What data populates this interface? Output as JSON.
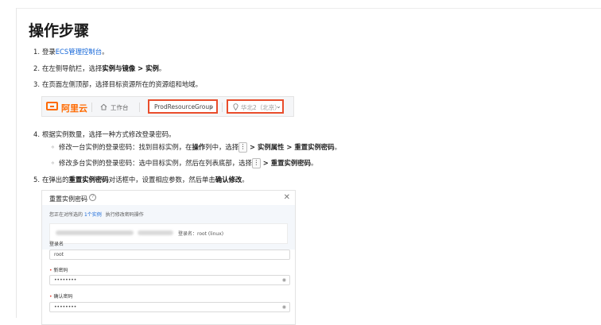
{
  "page": {
    "heading": "操作步骤"
  },
  "steps": [
    {
      "num": "1.",
      "pre": "登录",
      "link": "ECS管理控制台",
      "post": "。"
    },
    {
      "num": "2.",
      "pre": "在左侧导航栏，选择",
      "bold": "实例与镜像 > 实例",
      "post": "。"
    },
    {
      "num": "3.",
      "text": "在页面左侧顶部，选择目标资源所在的资源组和地域。"
    },
    {
      "num": "4.",
      "text": "根据实例数量，选择一种方式修改登录密码。",
      "subs": [
        {
          "bullet": "◦",
          "pre": "修改一台实例的登录密码：找到目标实例，在",
          "bold1": "操作",
          "mid": "列中，选择",
          "kbd": "⋮",
          "bold2": " > 实例属性 > 重置实例密码",
          "post": "。"
        },
        {
          "bullet": "◦",
          "pre": "修改多台实例的登录密码：选中目标实例，然后在列表底部，选择",
          "kbd": "⋮",
          "bold2": " > 重置实例密码",
          "post": "。"
        }
      ]
    },
    {
      "num": "5.",
      "pre": "在弹出的",
      "bold1": "重置实例密码",
      "mid": "对话框中，设置相应参数，然后单击",
      "bold2": "确认修改",
      "post": "。"
    }
  ],
  "console_bar": {
    "logo_text": "阿里云",
    "home_icon": "home-icon",
    "workbench": "工作台",
    "resource_group": "ProdResourceGroup",
    "region": "华北2（北京）",
    "chevron": "⌄"
  },
  "dialog": {
    "title": "重置实例密码",
    "close": "✕",
    "notice_pre": "您正在对所选的",
    "notice_link": "1个实例",
    "notice_post": "执行修改密码操作",
    "instance_user": "登录名：root (linux)",
    "fields": [
      {
        "label": "登录名",
        "required": false,
        "value": "root"
      },
      {
        "label": "新密码",
        "required": true,
        "value": "••••••••"
      },
      {
        "label": "确认密码",
        "required": true,
        "value": "••••••••"
      }
    ]
  },
  "colors": {
    "link": "#1466d8",
    "brand": "#ff6a00",
    "highlight": "#e94d2c"
  }
}
